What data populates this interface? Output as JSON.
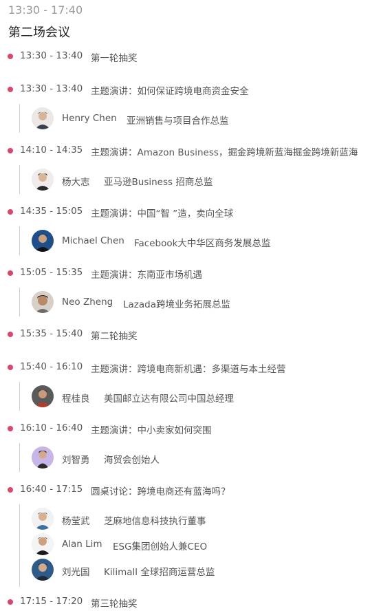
{
  "header": {
    "time_range": "13:30 - 17:40",
    "title": "第二场会议"
  },
  "schedule": [
    {
      "time": "13:30 - 13:40",
      "title": "第一轮抽奖",
      "speakers": []
    },
    {
      "time": "13:40 - 14:10",
      "title": "主题演讲：如何保证跨境电商资金安全",
      "speakers": [
        {
          "name": "Henry Chen",
          "role": "亚洲销售与项目合作总监"
        }
      ]
    },
    {
      "time": "14:10 - 14:35",
      "title": "主题演讲：Amazon Business，掘金跨境新蓝海掘金跨境新蓝海",
      "speakers": [
        {
          "name": "杨大志",
          "role": "亚马逊Business 招商总监"
        }
      ]
    },
    {
      "time": "14:35 - 15:05",
      "title": "主题演讲：中国“智 ”造，卖向全球",
      "speakers": [
        {
          "name": "Michael Chen",
          "role": "Facebook大中华区商务发展总监"
        }
      ]
    },
    {
      "time": "15:05 - 15:35",
      "title": "主题演讲：东南亚市场机遇",
      "speakers": [
        {
          "name": "Neo Zheng",
          "role": "Lazada跨境业务拓展总监"
        }
      ]
    },
    {
      "time": "15:35 - 15:40",
      "title": "第二轮抽奖",
      "speakers": []
    },
    {
      "time": "15:40 - 16:10",
      "title": "主题演讲：跨境电商新机遇：多渠道与本土经营",
      "speakers": [
        {
          "name": "程桂良",
          "role": "美国邮立达有限公司中国总经理"
        }
      ]
    },
    {
      "time": "16:10 - 16:40",
      "title": "主题演讲：中小卖家如何突围",
      "speakers": [
        {
          "name": "刘智勇",
          "role": "海贸会创始人"
        }
      ]
    },
    {
      "time": "16:40 - 17:15",
      "title": "圆桌讨论：跨境电商还有蓝海吗？",
      "speakers": [
        {
          "name": "杨莹武",
          "role": "芝麻地信息科技执行董事"
        },
        {
          "name": "Alan Lim",
          "role": "ESG集团创始人兼CEO"
        },
        {
          "name": "刘光国",
          "role": "Kilimall 全球招商运营总监"
        }
      ]
    },
    {
      "time": "17:15 - 17:20",
      "title": "第三轮抽奖",
      "speakers": []
    }
  ],
  "colors": {
    "dot": "#d9486a",
    "line": "#cfcfcf",
    "text": "#555555",
    "header_time": "#9a9a9a"
  }
}
